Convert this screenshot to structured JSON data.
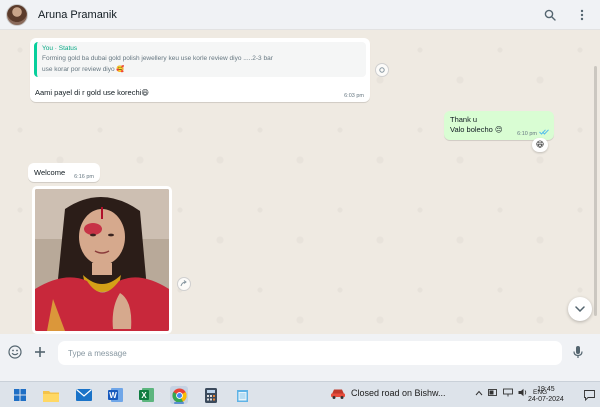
{
  "header": {
    "contact_name": "Aruna Pramanik",
    "search_icon": "search-icon",
    "menu_icon": "more-vertical-icon"
  },
  "messages": [
    {
      "direction": "in",
      "quote_author": "You · Status",
      "quote_line1": "Forming gold ba dubai gold polish jewellery keu use korle review diyo .....2-3 bar",
      "quote_line2": "use korar por review diyo 🥰",
      "text": "Aami payel di r gold use korechi😄",
      "time": "6:03 pm"
    },
    {
      "direction": "out",
      "line1": "Thank u",
      "line2": "Valo bolecho 😔",
      "time": "6:10 pm",
      "status": "read",
      "reaction": "😄"
    },
    {
      "direction": "in",
      "text": "Welcome",
      "time": "6:16 pm"
    },
    {
      "direction": "in",
      "type": "image",
      "content": "photo-selfie"
    }
  ],
  "composer": {
    "placeholder": "Type a message",
    "emoji_icon": "emoji-icon",
    "attach_icon": "plus-icon",
    "mic_icon": "mic-icon"
  },
  "taskbar": {
    "apps": [
      "windows-start",
      "file-explorer",
      "mail",
      "word",
      "excel",
      "chrome",
      "calculator",
      "notepad"
    ],
    "news_text": "Closed road on Bishw...",
    "tray_lang": "ENG",
    "time": "19:45",
    "date": "24-07-2024"
  }
}
